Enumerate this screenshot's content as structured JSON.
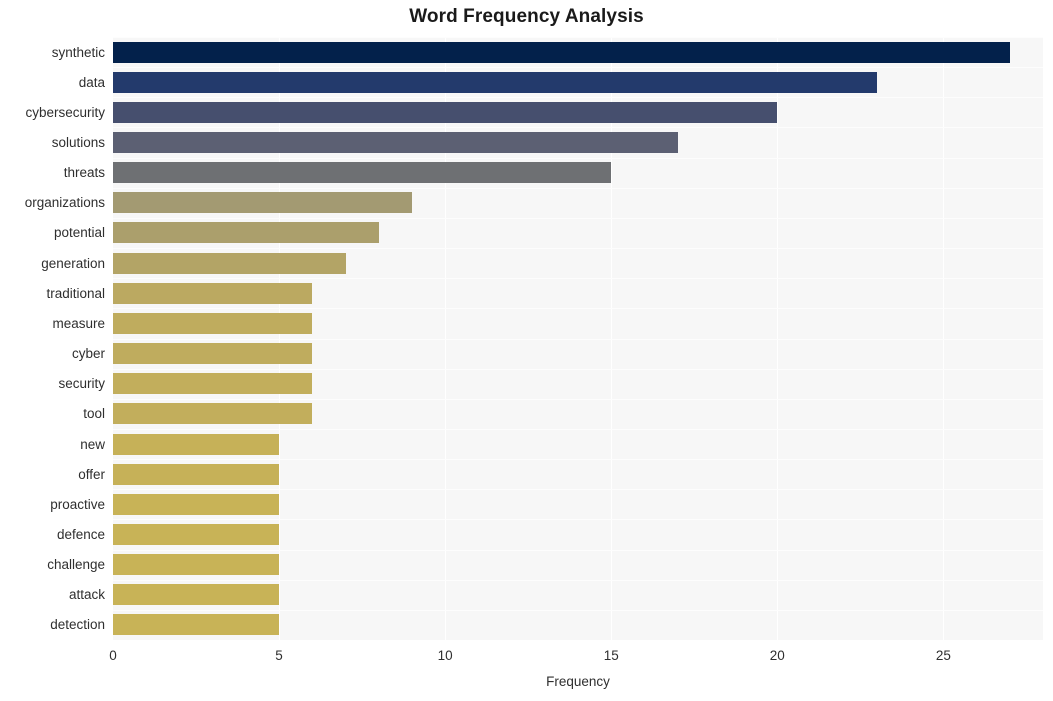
{
  "chart_data": {
    "type": "bar",
    "orientation": "horizontal",
    "title": "Word Frequency Analysis",
    "xlabel": "Frequency",
    "ylabel": "",
    "categories": [
      "synthetic",
      "data",
      "cybersecurity",
      "solutions",
      "threats",
      "organizations",
      "potential",
      "generation",
      "traditional",
      "measure",
      "cyber",
      "security",
      "tool",
      "new",
      "offer",
      "proactive",
      "defence",
      "challenge",
      "attack",
      "detection"
    ],
    "values": [
      27,
      23,
      20,
      17,
      15,
      9,
      8,
      7,
      6,
      6,
      6,
      6,
      6,
      5,
      5,
      5,
      5,
      5,
      5,
      5
    ],
    "bar_colors": [
      "#03214b",
      "#233a6c",
      "#464f6e",
      "#5c6073",
      "#6e7073",
      "#a39a72",
      "#ab9f6c",
      "#b3a466",
      "#bba961",
      "#bfac5e",
      "#bfac5e",
      "#c2ae5c",
      "#c2ae5c",
      "#c6b158",
      "#c6b158",
      "#c8b357",
      "#c8b357",
      "#c8b357",
      "#c8b357",
      "#c8b357"
    ],
    "xlim": [
      0,
      28
    ],
    "xticks": [
      0,
      5,
      10,
      15,
      20,
      25
    ],
    "xtick_labels": [
      "0",
      "5",
      "10",
      "15",
      "20",
      "25"
    ],
    "grid": true,
    "grid_color": "#ffffff",
    "plot_background": "#f7f7f7",
    "figure_background": "#ffffff",
    "legend": null
  }
}
